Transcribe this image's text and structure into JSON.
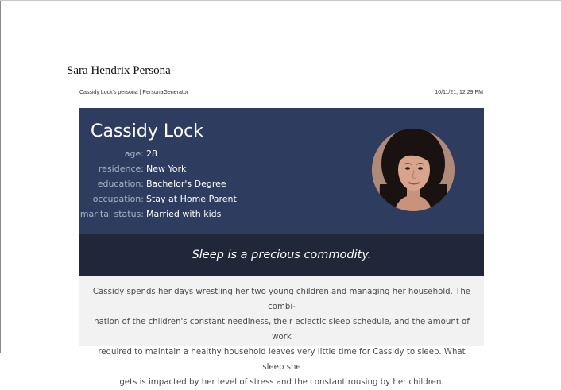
{
  "document": {
    "title": "Sara Hendrix Persona-",
    "print_header_left": "Cassidy Lock's persona | PersonaGenerator",
    "print_header_right": "10/11/21, 12:29 PM"
  },
  "persona": {
    "name": "Cassidy Lock",
    "details": [
      {
        "label": "age:",
        "value": "28"
      },
      {
        "label": "residence:",
        "value": "New York"
      },
      {
        "label": "education:",
        "value": "Bachelor's Degree"
      },
      {
        "label": "occupation:",
        "value": "Stay at Home Parent"
      },
      {
        "label": "marital status:",
        "value": "Married with kids"
      }
    ],
    "tagline": "Sleep is a precious commodity.",
    "bio_lines": [
      "Cassidy spends her days wrestling her two young children and managing her household. The combi-",
      "nation of the children's constant neediness, their eclectic sleep schedule, and the amount of work",
      "required to maintain a healthy household leaves very little time for Cassidy to sleep. What sleep she",
      "gets is impacted by her level of stress and the constant rousing by her children."
    ]
  },
  "colors": {
    "hero_bg": "#2e3d5f",
    "tagline_bg": "#1f2739",
    "bio_bg": "#f2f2f2",
    "label_color": "#a9b2c7"
  }
}
